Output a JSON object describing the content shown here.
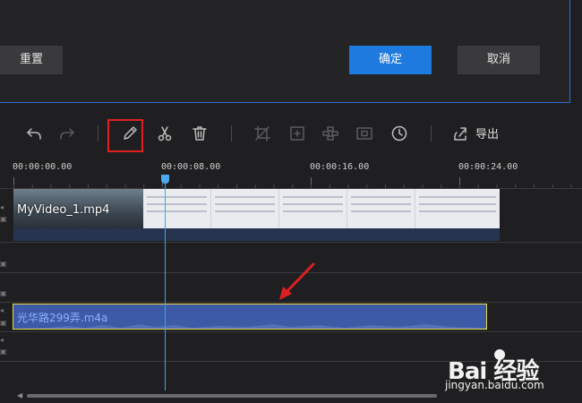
{
  "dialog": {
    "reset_label": "重置",
    "ok_label": "确定",
    "cancel_label": "取消"
  },
  "toolbar": {
    "tools": [
      "undo-icon",
      "redo-icon",
      "edit-icon",
      "cut-icon",
      "delete-icon",
      "crop-icon",
      "zoom-icon",
      "mosaic-icon",
      "freeze-frame-icon",
      "duration-icon",
      "export-icon"
    ],
    "export_label": "导出"
  },
  "ruler": {
    "ticks": [
      "00:00:00.00",
      "00:00:08.00",
      "00:00:16.00",
      "00:00:24.00"
    ]
  },
  "timeline": {
    "video_clip": {
      "name": "MyVideo_1.mp4"
    },
    "audio_clip": {
      "name": "光华路299弄.m4a"
    }
  },
  "watermark": {
    "brand": "Bai 经验",
    "url": "jingyan.baidu.com"
  },
  "colors": {
    "accent": "#1f7ae0",
    "playhead": "#36a8e6",
    "highlight": "#e02020",
    "audio_clip": "#3c5aa6"
  }
}
